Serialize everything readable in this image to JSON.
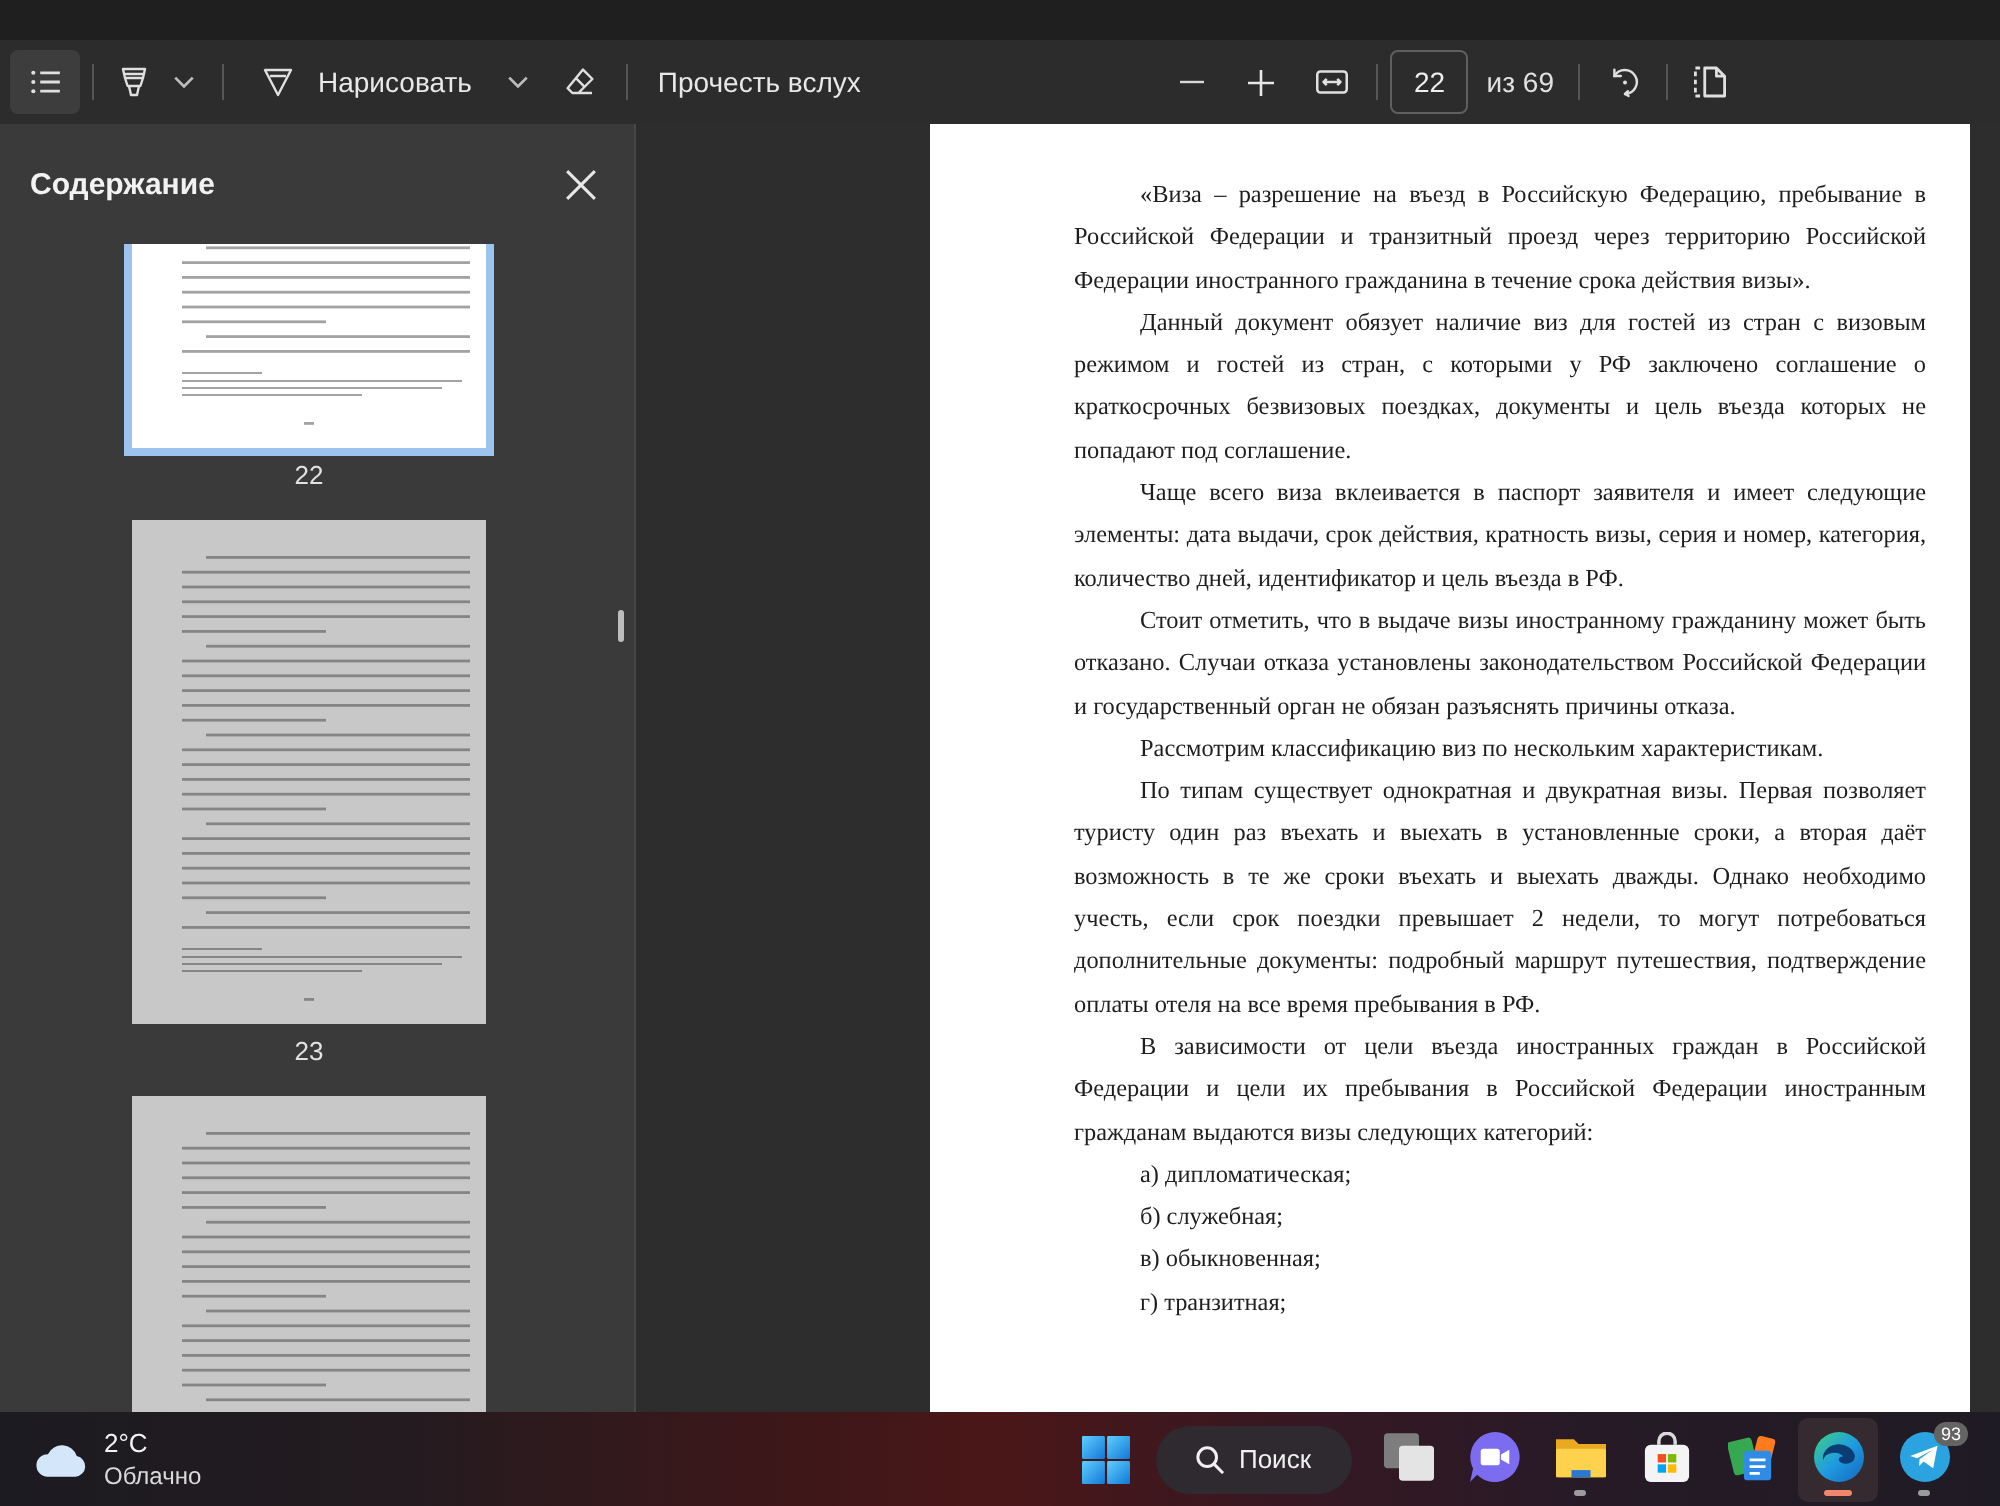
{
  "toolbar": {
    "contents_button": {
      "selected": true
    },
    "draw_button": {
      "label": "Нарисовать"
    },
    "read_aloud_button": {
      "label": "Прочесть вслух"
    },
    "page_field": {
      "value": "22"
    },
    "page_count": "из 69"
  },
  "sidebar": {
    "title": "Содержание",
    "thumbnails": [
      {
        "label": "22",
        "selected": true
      },
      {
        "label": "23",
        "selected": false
      },
      {
        "selected": false
      }
    ]
  },
  "document": {
    "blocks": [
      {
        "kind": "paragraph",
        "text": "«Виза – разрешение на въезд в Российскую Федерацию, пребывание в Российской Федерации и транзитный проезд через территорию Российской Федерации иностранного гражданина в течение срока действия визы»."
      },
      {
        "kind": "paragraph",
        "text": "Данный документ обязует наличие виз для гостей из стран с визовым режимом и гостей из стран, с которыми у РФ заключено соглашение о краткосрочных безвизовых поездках, документы и цель въезда которых не попадают под соглашение."
      },
      {
        "kind": "paragraph",
        "text": "Чаще всего виза вклеивается в паспорт заявителя и имеет следующие элементы: дата выдачи, срок действия, кратность визы, серия и номер, категория, количество дней, идентификатор и цель въезда в РФ."
      },
      {
        "kind": "paragraph",
        "text": "Стоит отметить, что в выдаче визы иностранному гражданину может быть отказано. Случаи отказа установлены законодательством Российской Федерации и государственный орган не обязан разъяснять причины отказа."
      },
      {
        "kind": "paragraph",
        "text": "Рассмотрим классификацию виз по нескольким характеристикам."
      },
      {
        "kind": "paragraph",
        "text": "По типам существует однократная и двукратная визы. Первая позволяет туристу один раз въехать и выехать в установленные сроки, а вторая даёт возможность в те же сроки въехать и выехать дважды. Однако необходимо учесть, если срок поездки превышает 2 недели, то могут потребоваться дополнительные документы: подробный маршрут путешествия, подтверждение оплаты отеля на все время пребывания в РФ."
      },
      {
        "kind": "paragraph",
        "text": "В зависимости от цели въезда иностранных граждан в Российской Федерации и цели их пребывания в Российской Федерации иностранным гражданам выдаются визы следующих категорий:"
      },
      {
        "kind": "list_item",
        "text": "а) дипломатическая;"
      },
      {
        "kind": "list_item",
        "text": "б) служебная;"
      },
      {
        "kind": "list_item",
        "text": "в) обыкновенная;"
      },
      {
        "kind": "list_item",
        "text": "г) транзитная;"
      }
    ]
  },
  "taskbar": {
    "weather": {
      "temperature": "2°C",
      "condition": "Облачно"
    },
    "search": {
      "label": "Поиск"
    },
    "apps": [
      {
        "kind": "task_view",
        "running": false,
        "selected": false
      },
      {
        "kind": "video_chat",
        "running": false,
        "selected": false
      },
      {
        "kind": "explorer",
        "running": true,
        "selected": false
      },
      {
        "kind": "store",
        "running": false,
        "selected": false
      },
      {
        "kind": "cards",
        "running": false,
        "selected": false
      },
      {
        "kind": "browser",
        "running": true,
        "selected": true
      },
      {
        "kind": "messenger",
        "running": true,
        "selected": false,
        "badge": "93"
      }
    ]
  }
}
